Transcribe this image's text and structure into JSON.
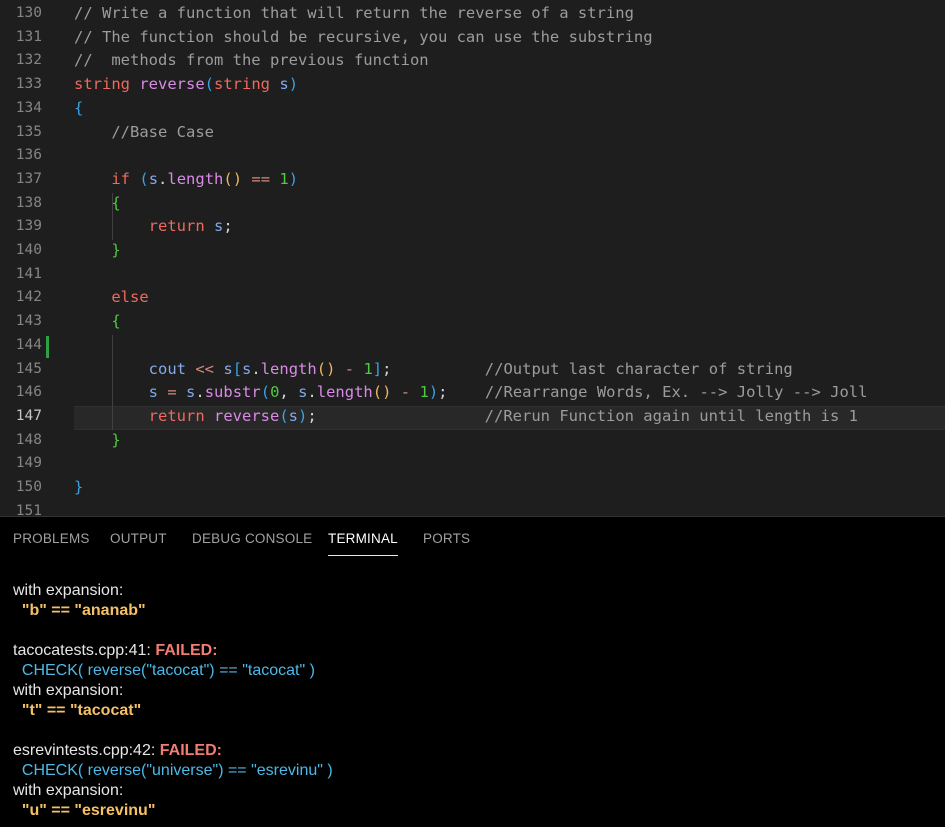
{
  "editor": {
    "lines": [
      {
        "n": "130",
        "code": "// Write a function that will return the reverse of a string"
      },
      {
        "n": "131",
        "code": "// The function should be recursive, you can use the substring"
      },
      {
        "n": "132",
        "code": "//  methods from the previous function"
      },
      {
        "n": "133",
        "code": "string reverse(string s)"
      },
      {
        "n": "134",
        "code": "{"
      },
      {
        "n": "135",
        "code": "    //Base Case"
      },
      {
        "n": "136",
        "code": ""
      },
      {
        "n": "137",
        "code": "    if (s.length() == 1)"
      },
      {
        "n": "138",
        "code": "    {"
      },
      {
        "n": "139",
        "code": "        return s;"
      },
      {
        "n": "140",
        "code": "    }"
      },
      {
        "n": "141",
        "code": ""
      },
      {
        "n": "142",
        "code": "    else"
      },
      {
        "n": "143",
        "code": "    {"
      },
      {
        "n": "144",
        "code": ""
      },
      {
        "n": "145",
        "code": "        cout << s[s.length() - 1];          //Output last character of string"
      },
      {
        "n": "146",
        "code": "        s = s.substr(0, s.length() - 1);    //Rearrange Words, Ex. --> Jolly --> Joll"
      },
      {
        "n": "147",
        "code": "        return reverse(s);                  //Rerun Function again until length is 1"
      },
      {
        "n": "148",
        "code": "    }"
      },
      {
        "n": "149",
        "code": ""
      },
      {
        "n": "150",
        "code": "}"
      },
      {
        "n": "151",
        "code": ""
      }
    ]
  },
  "panel": {
    "tabs": [
      "PROBLEMS",
      "OUTPUT",
      "DEBUG CONSOLE",
      "TERMINAL",
      "PORTS"
    ],
    "active_tab": "TERMINAL"
  },
  "terminal": {
    "lines": [
      {
        "text": "with expansion:"
      },
      {
        "text": "  \"b\" == \"ananab\"",
        "style": "val"
      },
      {
        "text": ""
      },
      {
        "prefix": "tacocatests.cpp:41: ",
        "text": "FAILED:",
        "style": "fail"
      },
      {
        "text": "  CHECK( reverse(\"tacocat\") == \"tacocat\" )",
        "style": "chk"
      },
      {
        "text": "with expansion:"
      },
      {
        "text": "  \"t\" == \"tacocat\"",
        "style": "val"
      },
      {
        "text": ""
      },
      {
        "prefix": "esrevintests.cpp:42: ",
        "text": "FAILED:",
        "style": "fail"
      },
      {
        "text": "  CHECK( reverse(\"universe\") == \"esrevinu\" )",
        "style": "chk"
      },
      {
        "text": "with expansion:"
      },
      {
        "text": "  \"u\" == \"esrevinu\"",
        "style": "val"
      }
    ]
  }
}
